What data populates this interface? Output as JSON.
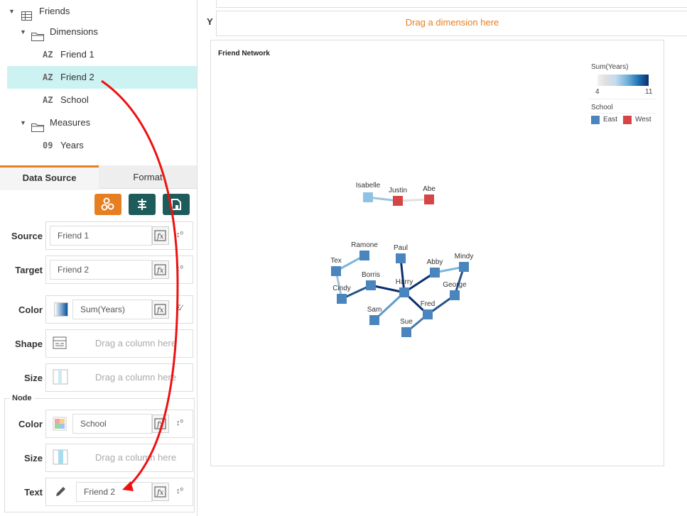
{
  "tree": {
    "root": {
      "label": "Friends",
      "icon": "table-icon"
    },
    "dimensions": {
      "label": "Dimensions",
      "icon": "folder-icon"
    },
    "dim_items": [
      {
        "badge": "AZ",
        "label": "Friend 1"
      },
      {
        "badge": "AZ",
        "label": "Friend 2"
      },
      {
        "badge": "AZ",
        "label": "School"
      }
    ],
    "measures": {
      "label": "Measures",
      "icon": "folder-icon"
    },
    "measure_items": [
      {
        "badge": "09",
        "label": "Years"
      }
    ]
  },
  "tabs": {
    "data_source": "Data Source",
    "format": "Format"
  },
  "toolbar": {
    "colors": {
      "orange": "#e67e22",
      "teal": "#1d5c5a"
    }
  },
  "fields": {
    "source": {
      "label": "Source",
      "value": "Friend 1"
    },
    "target": {
      "label": "Target",
      "value": "Friend 2"
    },
    "color": {
      "label": "Color",
      "value": "Sum(Years)"
    },
    "shape": {
      "label": "Shape",
      "placeholder": "Drag a column here"
    },
    "size": {
      "label": "Size",
      "placeholder": "Drag a column here"
    }
  },
  "node": {
    "title": "Node",
    "color": {
      "label": "Color",
      "value": "School"
    },
    "size": {
      "label": "Size",
      "placeholder": "Drag a column here"
    },
    "text": {
      "label": "Text",
      "value": "Friend 2"
    }
  },
  "axis": {
    "y_label": "Y",
    "y_drop": "Drag a dimension here"
  },
  "chart": {
    "title": "Friend Network",
    "legend": {
      "color_title": "Sum(Years)",
      "color_min": "4",
      "color_max": "11",
      "school_title": "School",
      "east": "East",
      "west": "West",
      "east_color": "#4a86bd",
      "west_color": "#d64545"
    }
  },
  "chart_data": {
    "type": "network",
    "title": "Friend Network",
    "color_scale": {
      "measure": "Sum(Years)",
      "min": 4,
      "max": 11
    },
    "nodes": [
      {
        "name": "Isabelle",
        "school": "East"
      },
      {
        "name": "Justin",
        "school": "West"
      },
      {
        "name": "Abe",
        "school": "West"
      },
      {
        "name": "Ramone",
        "school": "East"
      },
      {
        "name": "Tex",
        "school": "East"
      },
      {
        "name": "Paul",
        "school": "East"
      },
      {
        "name": "Abby",
        "school": "East"
      },
      {
        "name": "Mindy",
        "school": "East"
      },
      {
        "name": "Borris",
        "school": "East"
      },
      {
        "name": "Cindy",
        "school": "East"
      },
      {
        "name": "Harry",
        "school": "East"
      },
      {
        "name": "George",
        "school": "East"
      },
      {
        "name": "Fred",
        "school": "East"
      },
      {
        "name": "Sam",
        "school": "East"
      },
      {
        "name": "Sue",
        "school": "East"
      }
    ],
    "edges": [
      {
        "source": "Isabelle",
        "target": "Justin",
        "years": 6
      },
      {
        "source": "Justin",
        "target": "Abe",
        "years": 4
      },
      {
        "source": "Ramone",
        "target": "Tex",
        "years": 7
      },
      {
        "source": "Tex",
        "target": "Cindy",
        "years": 6
      },
      {
        "source": "Cindy",
        "target": "Borris",
        "years": 10
      },
      {
        "source": "Borris",
        "target": "Harry",
        "years": 11
      },
      {
        "source": "Paul",
        "target": "Harry",
        "years": 11
      },
      {
        "source": "Harry",
        "target": "Abby",
        "years": 11
      },
      {
        "source": "Abby",
        "target": "Mindy",
        "years": 7
      },
      {
        "source": "Mindy",
        "target": "George",
        "years": 10
      },
      {
        "source": "George",
        "target": "Fred",
        "years": 10
      },
      {
        "source": "Harry",
        "target": "Fred",
        "years": 11
      },
      {
        "source": "Harry",
        "target": "Sam",
        "years": 8
      },
      {
        "source": "Fred",
        "target": "Sue",
        "years": 9
      }
    ]
  }
}
